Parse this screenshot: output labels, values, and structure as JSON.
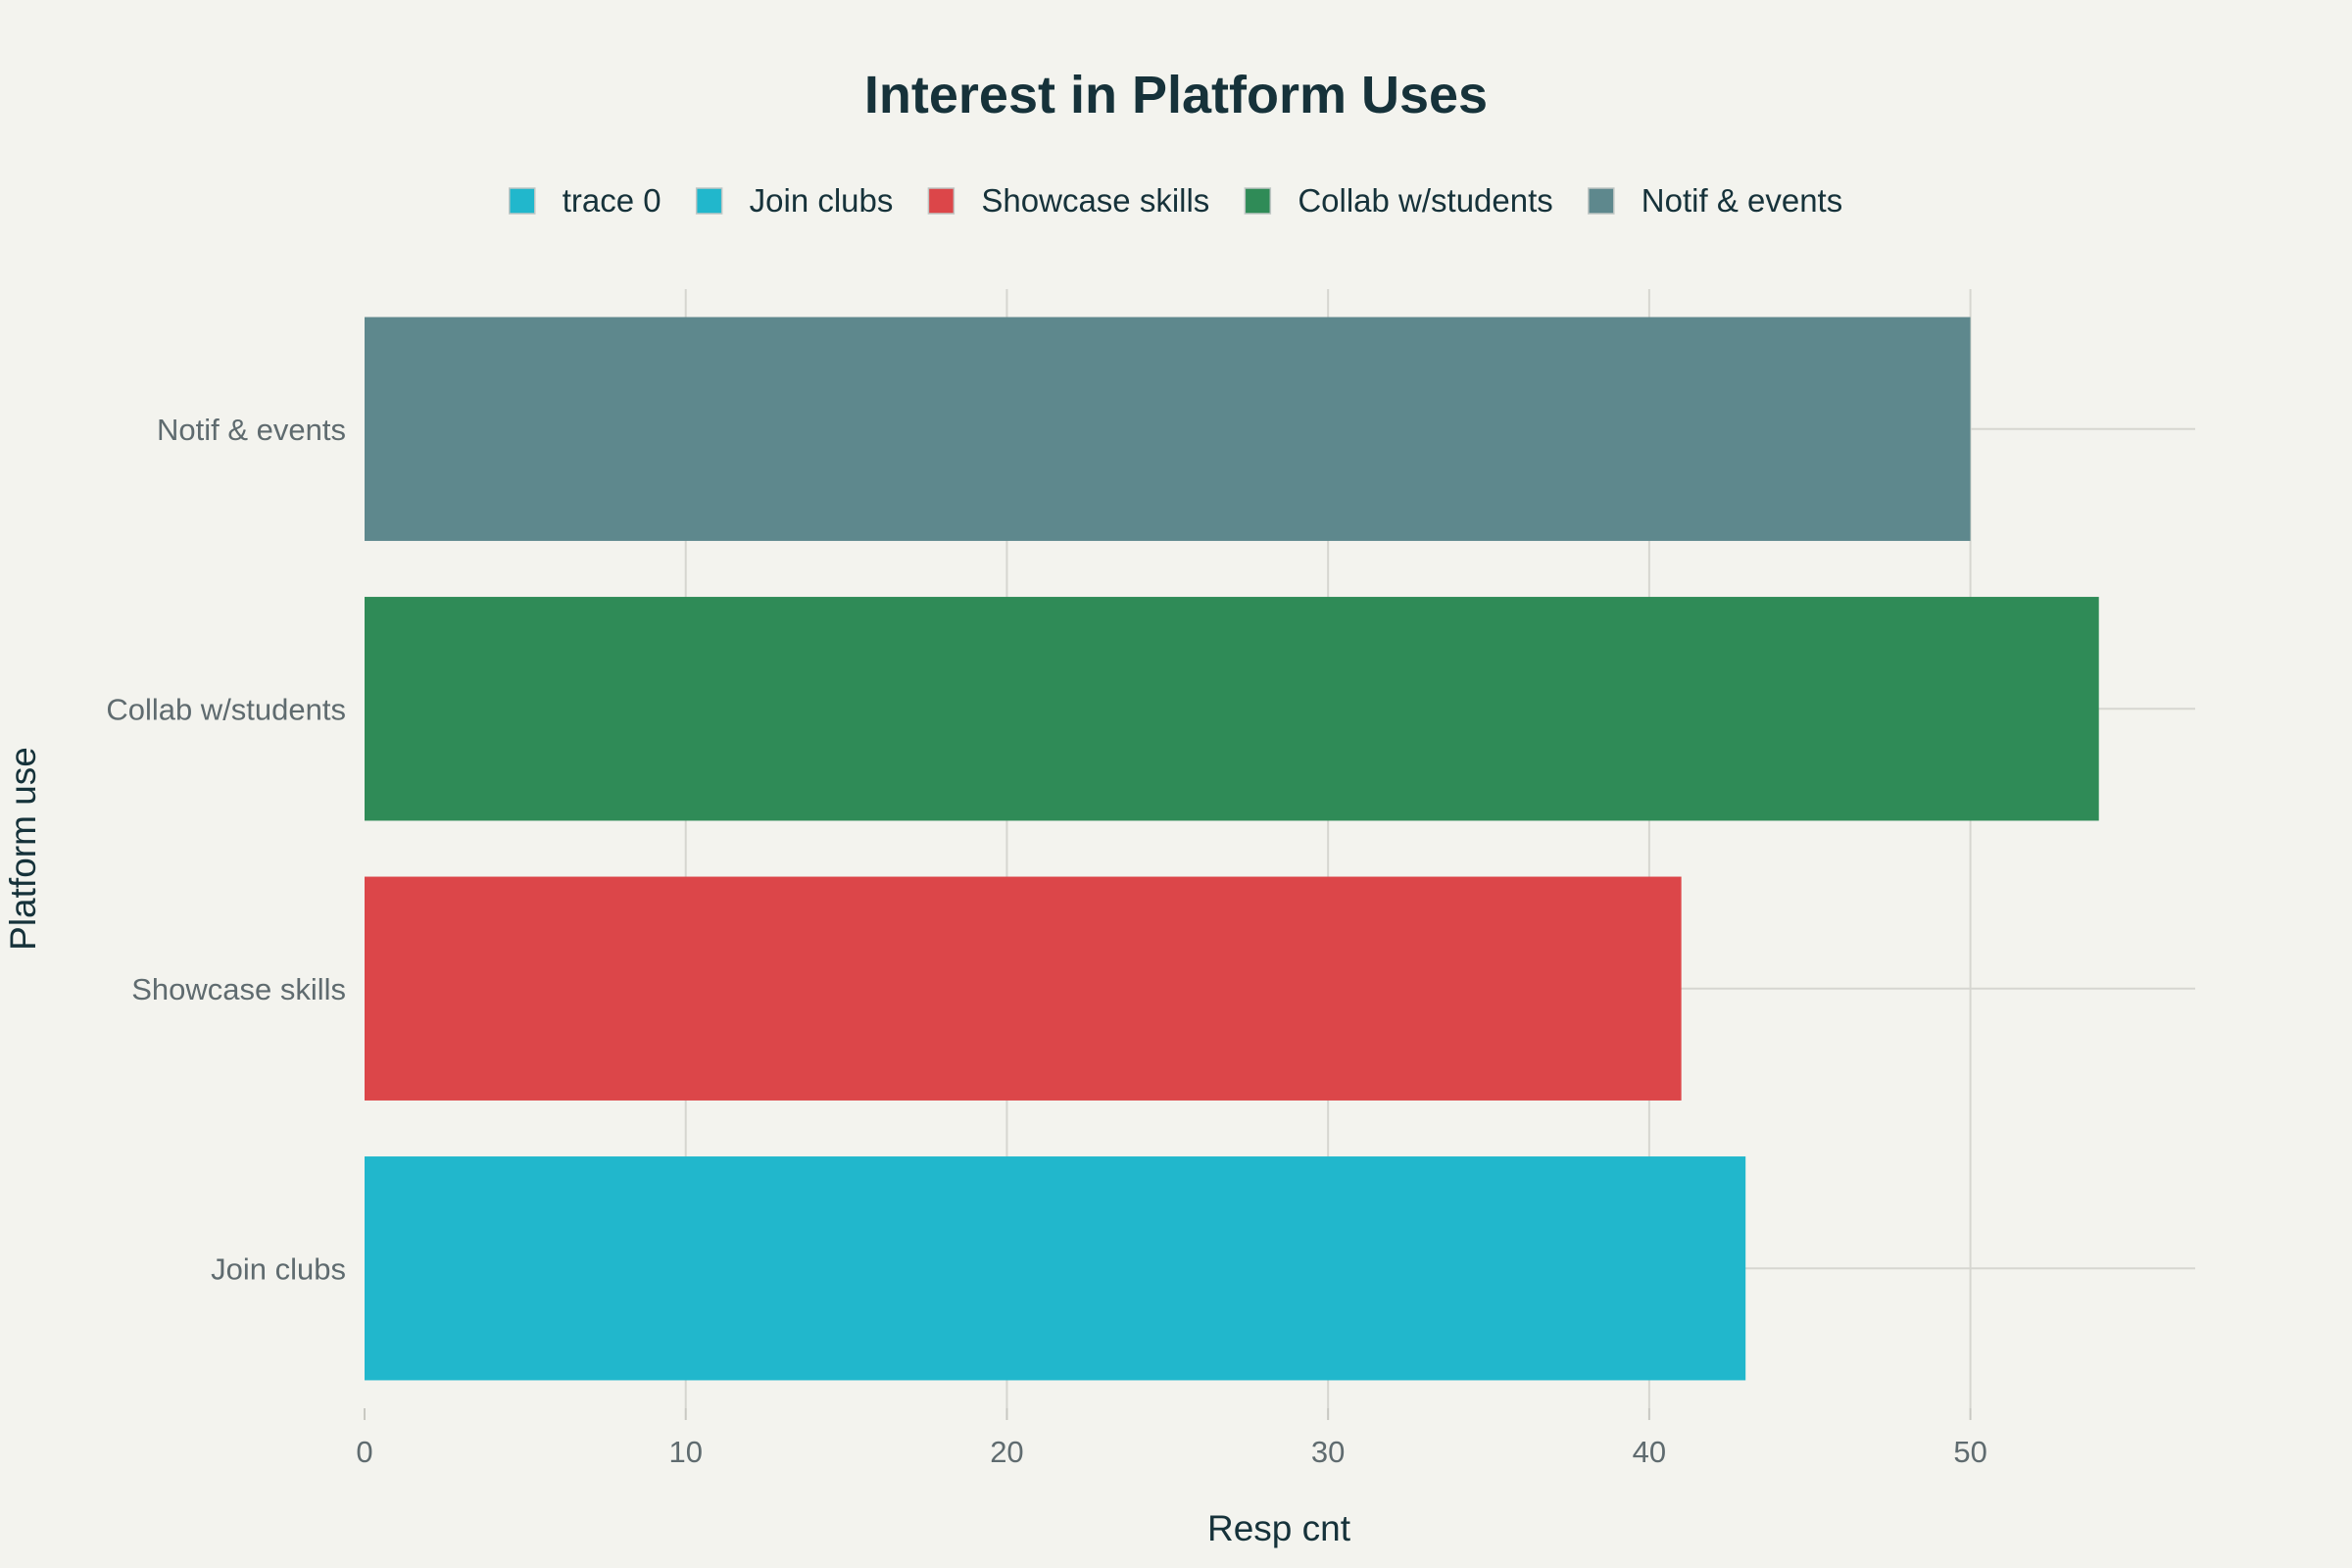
{
  "chart_data": {
    "type": "bar",
    "orientation": "horizontal",
    "title": "Interest in Platform Uses",
    "xlabel": "Resp cnt",
    "ylabel": "Platform use",
    "xlim": [
      0,
      57
    ],
    "x_ticks": [
      0,
      10,
      20,
      30,
      40,
      50
    ],
    "grid": true,
    "legend_placement": "top-center",
    "categories": [
      "Join clubs",
      "Showcase skills",
      "Collab w/students",
      "Notif & events"
    ],
    "values": [
      43,
      41,
      54,
      50
    ],
    "colors": [
      "#21b7cc",
      "#dc4649",
      "#2f8b57",
      "#5e888d"
    ],
    "legend": [
      {
        "label": "trace 0",
        "color": "#21b7cc"
      },
      {
        "label": "Join clubs",
        "color": "#21b7cc"
      },
      {
        "label": "Showcase skills",
        "color": "#dc4649"
      },
      {
        "label": "Collab w/students",
        "color": "#2f8b57"
      },
      {
        "label": "Notif & events",
        "color": "#5e888d"
      }
    ]
  }
}
